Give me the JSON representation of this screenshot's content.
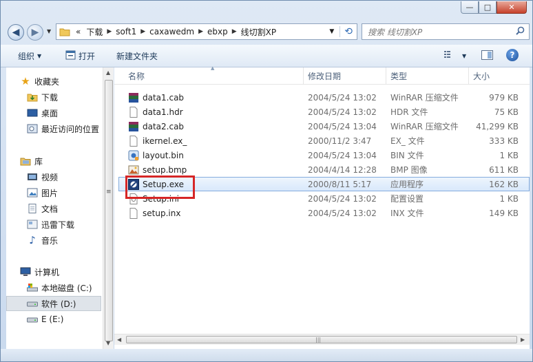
{
  "window": {
    "minimize_label": "—",
    "maximize_label": "□",
    "close_label": "✕"
  },
  "address": {
    "overflow": "«",
    "crumbs": [
      "下载",
      "soft1",
      "caxawedm",
      "ebxp",
      "线切割XP"
    ],
    "search_placeholder": "搜索 线切割XP"
  },
  "toolbar": {
    "organize": "组织",
    "open": "打开",
    "new_folder": "新建文件夹"
  },
  "nav": {
    "favorites": "收藏夹",
    "downloads": "下载",
    "desktop": "桌面",
    "recent": "最近访问的位置",
    "libraries": "库",
    "videos": "视频",
    "pictures": "图片",
    "documents": "文档",
    "xunlei": "迅雷下载",
    "music": "音乐",
    "computer": "计算机",
    "drive_c": "本地磁盘 (C:)",
    "drive_d": "软件 (D:)",
    "drive_e": "E (E:)"
  },
  "columns": {
    "name": "名称",
    "date": "修改日期",
    "type": "类型",
    "size": "大小"
  },
  "files": [
    {
      "name": "data1.cab",
      "date": "2004/5/24 13:02",
      "type": "WinRAR 压缩文件",
      "size": "979 KB"
    },
    {
      "name": "data1.hdr",
      "date": "2004/5/24 13:02",
      "type": "HDR 文件",
      "size": "75 KB"
    },
    {
      "name": "data2.cab",
      "date": "2004/5/24 13:04",
      "type": "WinRAR 压缩文件",
      "size": "41,299 KB"
    },
    {
      "name": "ikernel.ex_",
      "date": "2000/11/2 3:47",
      "type": "EX_ 文件",
      "size": "333 KB"
    },
    {
      "name": "layout.bin",
      "date": "2004/5/24 13:04",
      "type": "BIN 文件",
      "size": "1 KB"
    },
    {
      "name": "setup.bmp",
      "date": "2004/4/14 12:28",
      "type": "BMP 图像",
      "size": "611 KB"
    },
    {
      "name": "Setup.exe",
      "date": "2000/8/11 5:17",
      "type": "应用程序",
      "size": "162 KB"
    },
    {
      "name": "Setup.ini",
      "date": "2004/5/24 13:02",
      "type": "配置设置",
      "size": "1 KB"
    },
    {
      "name": "setup.inx",
      "date": "2004/5/24 13:02",
      "type": "INX 文件",
      "size": "149 KB"
    }
  ]
}
